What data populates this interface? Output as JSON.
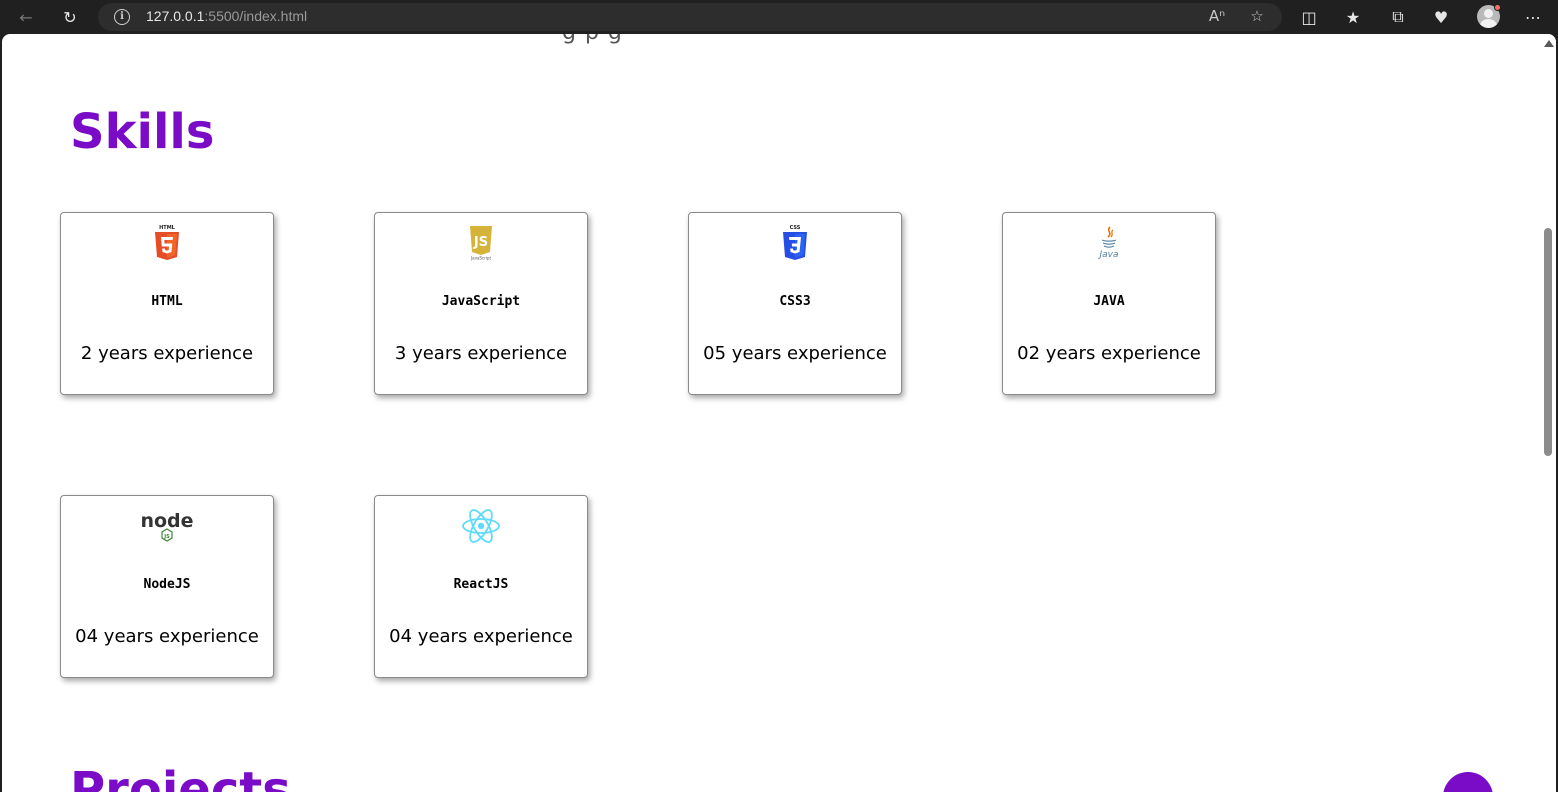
{
  "browser": {
    "url_host": "127.0.0.1",
    "url_rest": ":5500/index.html"
  },
  "page": {
    "cut_off_heading": "g  p  g",
    "skills_title": "Skills",
    "projects_title": "Projects",
    "skills": [
      {
        "name": "HTML",
        "experience": "2 years experience",
        "icon": "html5-logo-icon",
        "logo_text": "HTML",
        "color": "#e44d26"
      },
      {
        "name": "JavaScript",
        "experience": "3 years experience",
        "icon": "javascript-logo-icon",
        "logo_text": "JavaScript",
        "color": "#d6b43a"
      },
      {
        "name": "CSS3",
        "experience": "05 years experience",
        "icon": "css3-logo-icon",
        "logo_text": "CSS",
        "color": "#264de4"
      },
      {
        "name": "JAVA",
        "experience": "02 years experience",
        "icon": "java-logo-icon",
        "logo_text": "Java",
        "color": "#5382a1"
      },
      {
        "name": "NodeJS",
        "experience": "04 years experience",
        "icon": "nodejs-logo-icon",
        "logo_text": "node",
        "color": "#3c873a"
      },
      {
        "name": "ReactJS",
        "experience": "04 years experience",
        "icon": "react-logo-icon",
        "logo_text": "",
        "color": "#61dafb"
      }
    ]
  },
  "colors": {
    "accent": "#7a0cc8"
  }
}
